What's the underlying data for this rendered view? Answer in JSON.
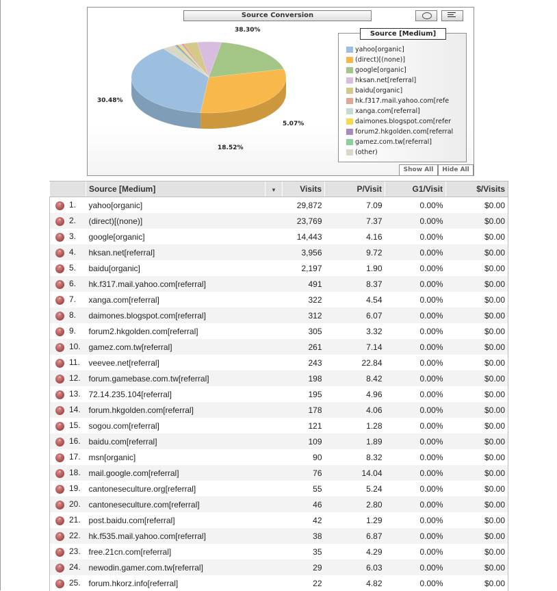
{
  "chart": {
    "title": "Source Conversion",
    "pie_labels": [
      "38.30%",
      "30.48%",
      "18.52%",
      "5.07%"
    ],
    "legend_title": "Source [Medium]",
    "legend": [
      {
        "label": "yahoo[organic]",
        "color": "#9cbfe0"
      },
      {
        "label": "(direct)[(none)]",
        "color": "#f9b84b"
      },
      {
        "label": "google[organic]",
        "color": "#a3c586"
      },
      {
        "label": "hksan.net[referral]",
        "color": "#d9bde0"
      },
      {
        "label": "baidu[organic]",
        "color": "#d4c98b"
      },
      {
        "label": "hk.f317.mail.yahoo.com[refe",
        "color": "#e3a596"
      },
      {
        "label": "xanga.com[referral]",
        "color": "#c0dcd9"
      },
      {
        "label": "daimones.blogspot.com[refer",
        "color": "#f6d84f"
      },
      {
        "label": "forum2.hkgolden.com[referral",
        "color": "#a68bbf"
      },
      {
        "label": "gamez.com.tw[referral]",
        "color": "#8fcf9e"
      },
      {
        "label": "(other)",
        "color": "#d9d8c6"
      }
    ],
    "show_all": "Show All",
    "hide_all": "Hide All"
  },
  "chart_data": {
    "type": "pie",
    "title": "Source Conversion",
    "labels": [
      "yahoo[organic]",
      "(direct)[(none)]",
      "google[organic]",
      "hksan.net[referral]",
      "baidu[organic]",
      "hk.f317.mail.yahoo.com[referral]",
      "xanga.com[referral]",
      "daimones.blogspot.com[referral]",
      "forum2.hkgolden.com[referral]",
      "gamez.com.tw[referral]",
      "(other)"
    ],
    "values": [
      38.3,
      30.48,
      18.52,
      5.07,
      2.82,
      0.63,
      0.41,
      0.4,
      0.39,
      0.33,
      2.65
    ],
    "legend_position": "right"
  },
  "table": {
    "headers": [
      "Source [Medium]",
      "Visits",
      "P/Visit",
      "G1/Visit",
      "$/Visits"
    ],
    "rows": [
      {
        "idx": "1.",
        "source": "yahoo[organic]",
        "visits": "29,872",
        "pv": "7.09",
        "g1": "0.00%",
        "dv": "$0.00"
      },
      {
        "idx": "2.",
        "source": "(direct)[(none)]",
        "visits": "23,769",
        "pv": "7.37",
        "g1": "0.00%",
        "dv": "$0.00"
      },
      {
        "idx": "3.",
        "source": "google[organic]",
        "visits": "14,443",
        "pv": "4.16",
        "g1": "0.00%",
        "dv": "$0.00"
      },
      {
        "idx": "4.",
        "source": "hksan.net[referral]",
        "visits": "3,956",
        "pv": "9.72",
        "g1": "0.00%",
        "dv": "$0.00"
      },
      {
        "idx": "5.",
        "source": "baidu[organic]",
        "visits": "2,197",
        "pv": "1.90",
        "g1": "0.00%",
        "dv": "$0.00"
      },
      {
        "idx": "6.",
        "source": "hk.f317.mail.yahoo.com[referral]",
        "visits": "491",
        "pv": "8.37",
        "g1": "0.00%",
        "dv": "$0.00"
      },
      {
        "idx": "7.",
        "source": "xanga.com[referral]",
        "visits": "322",
        "pv": "4.54",
        "g1": "0.00%",
        "dv": "$0.00"
      },
      {
        "idx": "8.",
        "source": "daimones.blogspot.com[referral]",
        "visits": "312",
        "pv": "6.07",
        "g1": "0.00%",
        "dv": "$0.00"
      },
      {
        "idx": "9.",
        "source": "forum2.hkgolden.com[referral]",
        "visits": "305",
        "pv": "3.32",
        "g1": "0.00%",
        "dv": "$0.00"
      },
      {
        "idx": "10.",
        "source": "gamez.com.tw[referral]",
        "visits": "261",
        "pv": "7.14",
        "g1": "0.00%",
        "dv": "$0.00"
      },
      {
        "idx": "11.",
        "source": "veevee.net[referral]",
        "visits": "243",
        "pv": "22.84",
        "g1": "0.00%",
        "dv": "$0.00"
      },
      {
        "idx": "12.",
        "source": "forum.gamebase.com.tw[referral]",
        "visits": "198",
        "pv": "8.42",
        "g1": "0.00%",
        "dv": "$0.00"
      },
      {
        "idx": "13.",
        "source": "72.14.235.104[referral]",
        "visits": "195",
        "pv": "4.96",
        "g1": "0.00%",
        "dv": "$0.00"
      },
      {
        "idx": "14.",
        "source": "forum.hkgolden.com[referral]",
        "visits": "178",
        "pv": "4.06",
        "g1": "0.00%",
        "dv": "$0.00"
      },
      {
        "idx": "15.",
        "source": "sogou.com[referral]",
        "visits": "121",
        "pv": "1.28",
        "g1": "0.00%",
        "dv": "$0.00"
      },
      {
        "idx": "16.",
        "source": "baidu.com[referral]",
        "visits": "109",
        "pv": "1.89",
        "g1": "0.00%",
        "dv": "$0.00"
      },
      {
        "idx": "17.",
        "source": "msn[organic]",
        "visits": "90",
        "pv": "8.32",
        "g1": "0.00%",
        "dv": "$0.00"
      },
      {
        "idx": "18.",
        "source": "mail.google.com[referral]",
        "visits": "76",
        "pv": "14.04",
        "g1": "0.00%",
        "dv": "$0.00"
      },
      {
        "idx": "19.",
        "source": "cantoneseculture.org[referral]",
        "visits": "55",
        "pv": "5.24",
        "g1": "0.00%",
        "dv": "$0.00"
      },
      {
        "idx": "20.",
        "source": "cantoneseculture.com[referral]",
        "visits": "46",
        "pv": "2.80",
        "g1": "0.00%",
        "dv": "$0.00"
      },
      {
        "idx": "21.",
        "source": "post.baidu.com[referral]",
        "visits": "42",
        "pv": "1.29",
        "g1": "0.00%",
        "dv": "$0.00"
      },
      {
        "idx": "22.",
        "source": "hk.f535.mail.yahoo.com[referral]",
        "visits": "38",
        "pv": "6.87",
        "g1": "0.00%",
        "dv": "$0.00"
      },
      {
        "idx": "23.",
        "source": "free.21cn.com[referral]",
        "visits": "35",
        "pv": "4.29",
        "g1": "0.00%",
        "dv": "$0.00"
      },
      {
        "idx": "24.",
        "source": "newodin.gamer.com.tw[referral]",
        "visits": "29",
        "pv": "6.03",
        "g1": "0.00%",
        "dv": "$0.00"
      },
      {
        "idx": "25.",
        "source": "forum.hkorz.info[referral]",
        "visits": "22",
        "pv": "4.82",
        "g1": "0.00%",
        "dv": "$0.00"
      }
    ]
  }
}
